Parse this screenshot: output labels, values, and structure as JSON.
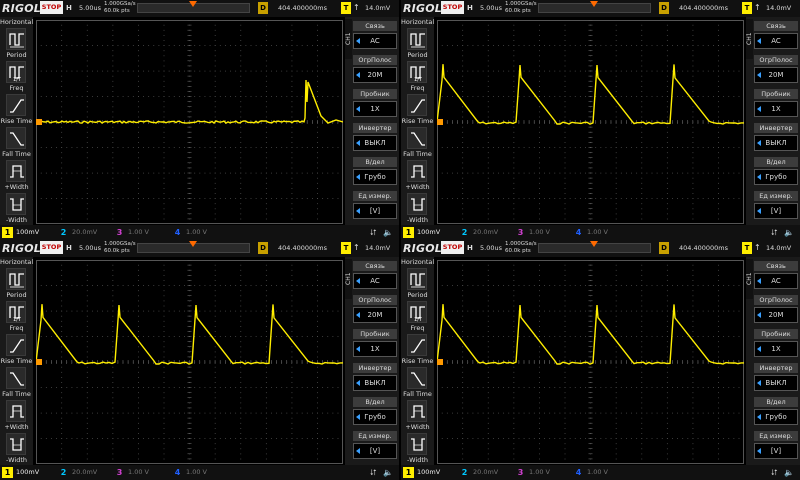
{
  "common": {
    "brand": "RIGOL",
    "run_state": "STOP",
    "h_label": "H",
    "timebase": "5.00us",
    "sample_rate": "1.000GSa/s",
    "memory_depth": "60.0k pts",
    "delay_label": "D",
    "delay": "404.400000ms",
    "trigger_label": "T",
    "trigger_edge": "↑",
    "trigger_level": "14.0mV",
    "channel_tab": "CH1",
    "channel_marker": "1",
    "left_menu": {
      "header": "Horizontal",
      "items": [
        {
          "label": "Period"
        },
        {
          "label": "Freq"
        },
        {
          "label": "Rise Time"
        },
        {
          "label": "Fall Time"
        },
        {
          "label": "+Width"
        },
        {
          "label": "-Width"
        }
      ]
    },
    "right_menu": [
      {
        "title": "Связь",
        "value": "AC"
      },
      {
        "title": "ОгрПолос",
        "value": "20M"
      },
      {
        "title": "Пробник",
        "value": "1X"
      },
      {
        "title": "Инвертер",
        "value": "ВЫКЛ"
      },
      {
        "title": "В/дел",
        "value": "Грубо"
      },
      {
        "title": "Ед измер.",
        "value": "[V]"
      }
    ],
    "channels": [
      {
        "num": "1",
        "value": "100mV",
        "color": "#ffee00"
      },
      {
        "num": "2",
        "value": "20.0mV",
        "color": "#00c8ff"
      },
      {
        "num": "3",
        "value": "1.00 V",
        "color": "#d040d0"
      },
      {
        "num": "4",
        "value": "1.00 V",
        "color": "#2060ff"
      }
    ],
    "usb_icon": "usb-icon",
    "speaker_icon": "speaker-icon"
  },
  "screens": [
    {
      "id": "top-left",
      "waveform": "single-pulse"
    },
    {
      "id": "top-right",
      "waveform": "sawtooth-4"
    },
    {
      "id": "bottom-left",
      "waveform": "sawtooth-4"
    },
    {
      "id": "bottom-right",
      "waveform": "sawtooth-4"
    }
  ]
}
